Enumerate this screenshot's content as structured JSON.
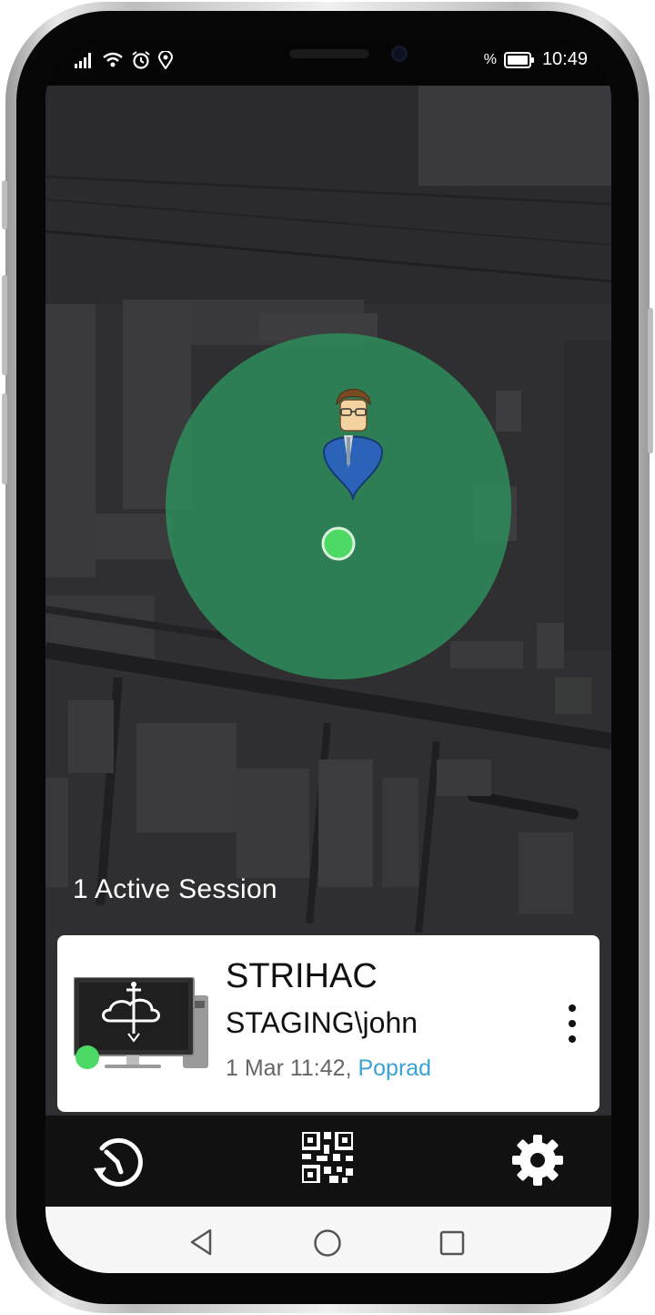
{
  "status_bar": {
    "battery_percent_symbol": "%",
    "time": "10:49",
    "icons": [
      "signal-icon",
      "wifi-icon",
      "alarm-icon",
      "location-icon",
      "battery-icon"
    ]
  },
  "map": {
    "accuracy_circle_color": "#2f8a5a",
    "location_dot_color": "#4cd964"
  },
  "sessions": {
    "title": "1 Active Session",
    "items": [
      {
        "computer_name": "STRIHAC",
        "user": "STAGING\\john",
        "time": "1 Mar 11:42",
        "separator": ", ",
        "location": "Poprad",
        "status_color": "#4cd964"
      }
    ]
  },
  "bottom_nav": {
    "items": [
      "history-icon",
      "qr-code-icon",
      "settings-icon"
    ]
  },
  "system_nav": {
    "items": [
      "back-icon",
      "home-icon",
      "recents-icon"
    ]
  },
  "colors": {
    "accent_link": "#3aa3d4",
    "map_background": "#2b2b2d"
  }
}
